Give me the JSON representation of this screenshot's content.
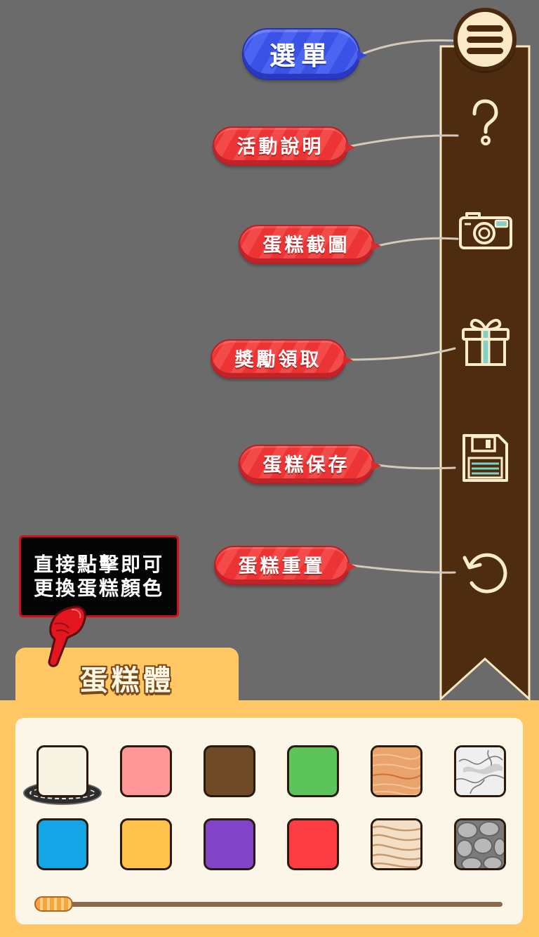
{
  "menu": {
    "label": "選單",
    "toggle_icon": "hamburger-menu-icon",
    "items": [
      {
        "label": "活動說明",
        "icon": "question-icon"
      },
      {
        "label": "蛋糕截圖",
        "icon": "camera-icon"
      },
      {
        "label": "獎勵領取",
        "icon": "gift-icon"
      },
      {
        "label": "蛋糕保存",
        "icon": "save-icon"
      },
      {
        "label": "蛋糕重置",
        "icon": "reset-icon"
      }
    ]
  },
  "tooltip": {
    "lines": [
      "直接點擊即可",
      "更換蛋糕顏色"
    ],
    "pointer_icon": "pointing-hand-icon"
  },
  "panel": {
    "tab_label": "蛋糕體",
    "swatches": [
      {
        "color": "#f8f4e3",
        "texture": null,
        "selected": true
      },
      {
        "color": "#ff9799",
        "texture": null,
        "selected": false
      },
      {
        "color": "#6e4b26",
        "texture": null,
        "selected": false
      },
      {
        "color": "#5dc35b",
        "texture": null,
        "selected": false
      },
      {
        "color": "#e9a46e",
        "texture": "wood-texture",
        "selected": false
      },
      {
        "color": "#efefef",
        "texture": "marble-texture",
        "selected": false
      },
      {
        "color": "#14a5e6",
        "texture": null,
        "selected": false
      },
      {
        "color": "#ffc24b",
        "texture": null,
        "selected": false
      },
      {
        "color": "#8244c7",
        "texture": null,
        "selected": false
      },
      {
        "color": "#fb3d43",
        "texture": null,
        "selected": false
      },
      {
        "color": "#f4dfc4",
        "texture": "wood-grain-texture",
        "selected": false
      },
      {
        "color": "#7a7a7a",
        "texture": "stone-texture",
        "selected": false
      }
    ],
    "scroll_position": 0
  },
  "colors": {
    "background": "#6b6b6b",
    "banner": "#4e2c10",
    "banner_trim": "#f7e6bf",
    "label_red": "#ec3434",
    "menu_blue": "#3a52e6",
    "panel": "#ffc865",
    "card": "#fcf6e8"
  }
}
